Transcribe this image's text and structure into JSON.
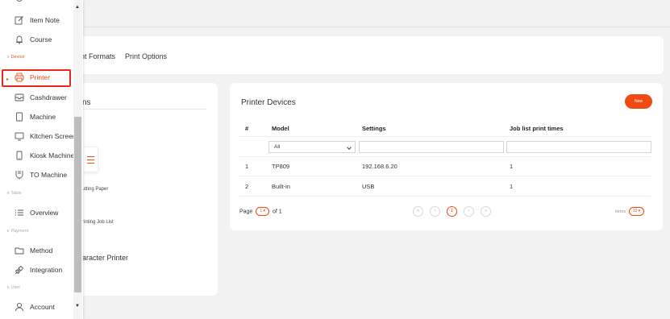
{
  "tabs": [
    {
      "label": "nt Formats"
    },
    {
      "label": "Print Options"
    }
  ],
  "left_card": {
    "heading": "ns",
    "items": [
      "utting Paper",
      "rinting Job List"
    ],
    "big_item": "aracter Printer"
  },
  "printer_devices": {
    "title": "Printer Devices",
    "new_label": "New",
    "columns": [
      "#",
      "Model",
      "Settings",
      "Job list print times"
    ],
    "filter_value": "All",
    "rows": [
      {
        "num": "1",
        "model": "TP809",
        "settings": "192.168.6.20",
        "times": "1"
      },
      {
        "num": "2",
        "model": "Built-in",
        "settings": "USB",
        "times": "1"
      }
    ],
    "pager": {
      "page_label": "Page",
      "page_value": "1 ▾",
      "of_label": "of 1",
      "current": "1",
      "items_label": "items",
      "items_value": "10 ▾"
    }
  },
  "sidebar": {
    "items": [
      {
        "label": "Item Note",
        "icon": "edit-icon"
      },
      {
        "label": "Course",
        "icon": "bell-icon"
      },
      {
        "label": "Printer",
        "icon": "printer-icon"
      },
      {
        "label": "Cashdrawer",
        "icon": "cashdrawer-icon"
      },
      {
        "label": "Machine",
        "icon": "tablet-icon"
      },
      {
        "label": "Kitchen Screen",
        "icon": "monitor-icon"
      },
      {
        "label": "Kiosk Machine",
        "icon": "kiosk-icon"
      },
      {
        "label": "TO Machine",
        "icon": "to-machine-icon"
      },
      {
        "label": "Overview",
        "icon": "list-icon"
      },
      {
        "label": "Method",
        "icon": "wallet-icon"
      },
      {
        "label": "Integration",
        "icon": "plug-icon"
      },
      {
        "label": "Account",
        "icon": "user-icon"
      }
    ],
    "sections": [
      "Device",
      "Table",
      "Payment",
      "User"
    ]
  },
  "colors": {
    "accent": "#ee4a12",
    "highlight_border": "#e8271c"
  }
}
